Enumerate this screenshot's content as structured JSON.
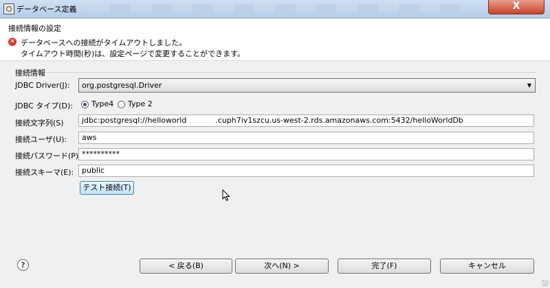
{
  "window": {
    "title": "データベース定義",
    "close_label": "X"
  },
  "header": {
    "section_title": "接続情報の設定",
    "error_line1": "データベースへの接続がタイムアウトしました。",
    "error_line2": "タイムアウト時間(秒)は、設定ページで変更することができます。"
  },
  "group": {
    "label": "接続情報"
  },
  "form": {
    "driver_label": "JDBC Driver(J):",
    "driver_value": "org.postgresql.Driver",
    "type_label": "JDBC タイプ(D):",
    "type_options": [
      "Type4",
      "Type 2"
    ],
    "type_selected": "Type4",
    "url_label": "接続文字列(S)",
    "url_value": "jdbc:postgresql://helloworld            .cuph7iv1szcu.us-west-2.rds.amazonaws.com:5432/helloWorldDb",
    "user_label": "接続ユーザ(U):",
    "user_value": "aws",
    "password_label": "接続パスワード(P):",
    "password_value": "**********",
    "schema_label": "接続スキーマ(E):",
    "schema_value": "public",
    "test_button": "テスト接続(T)"
  },
  "footer": {
    "help_icon": "?",
    "back_button": "< 戻る(B)",
    "next_button": "次へ(N) >",
    "finish_button": "完了(F)",
    "cancel_button": "キャンセル"
  }
}
